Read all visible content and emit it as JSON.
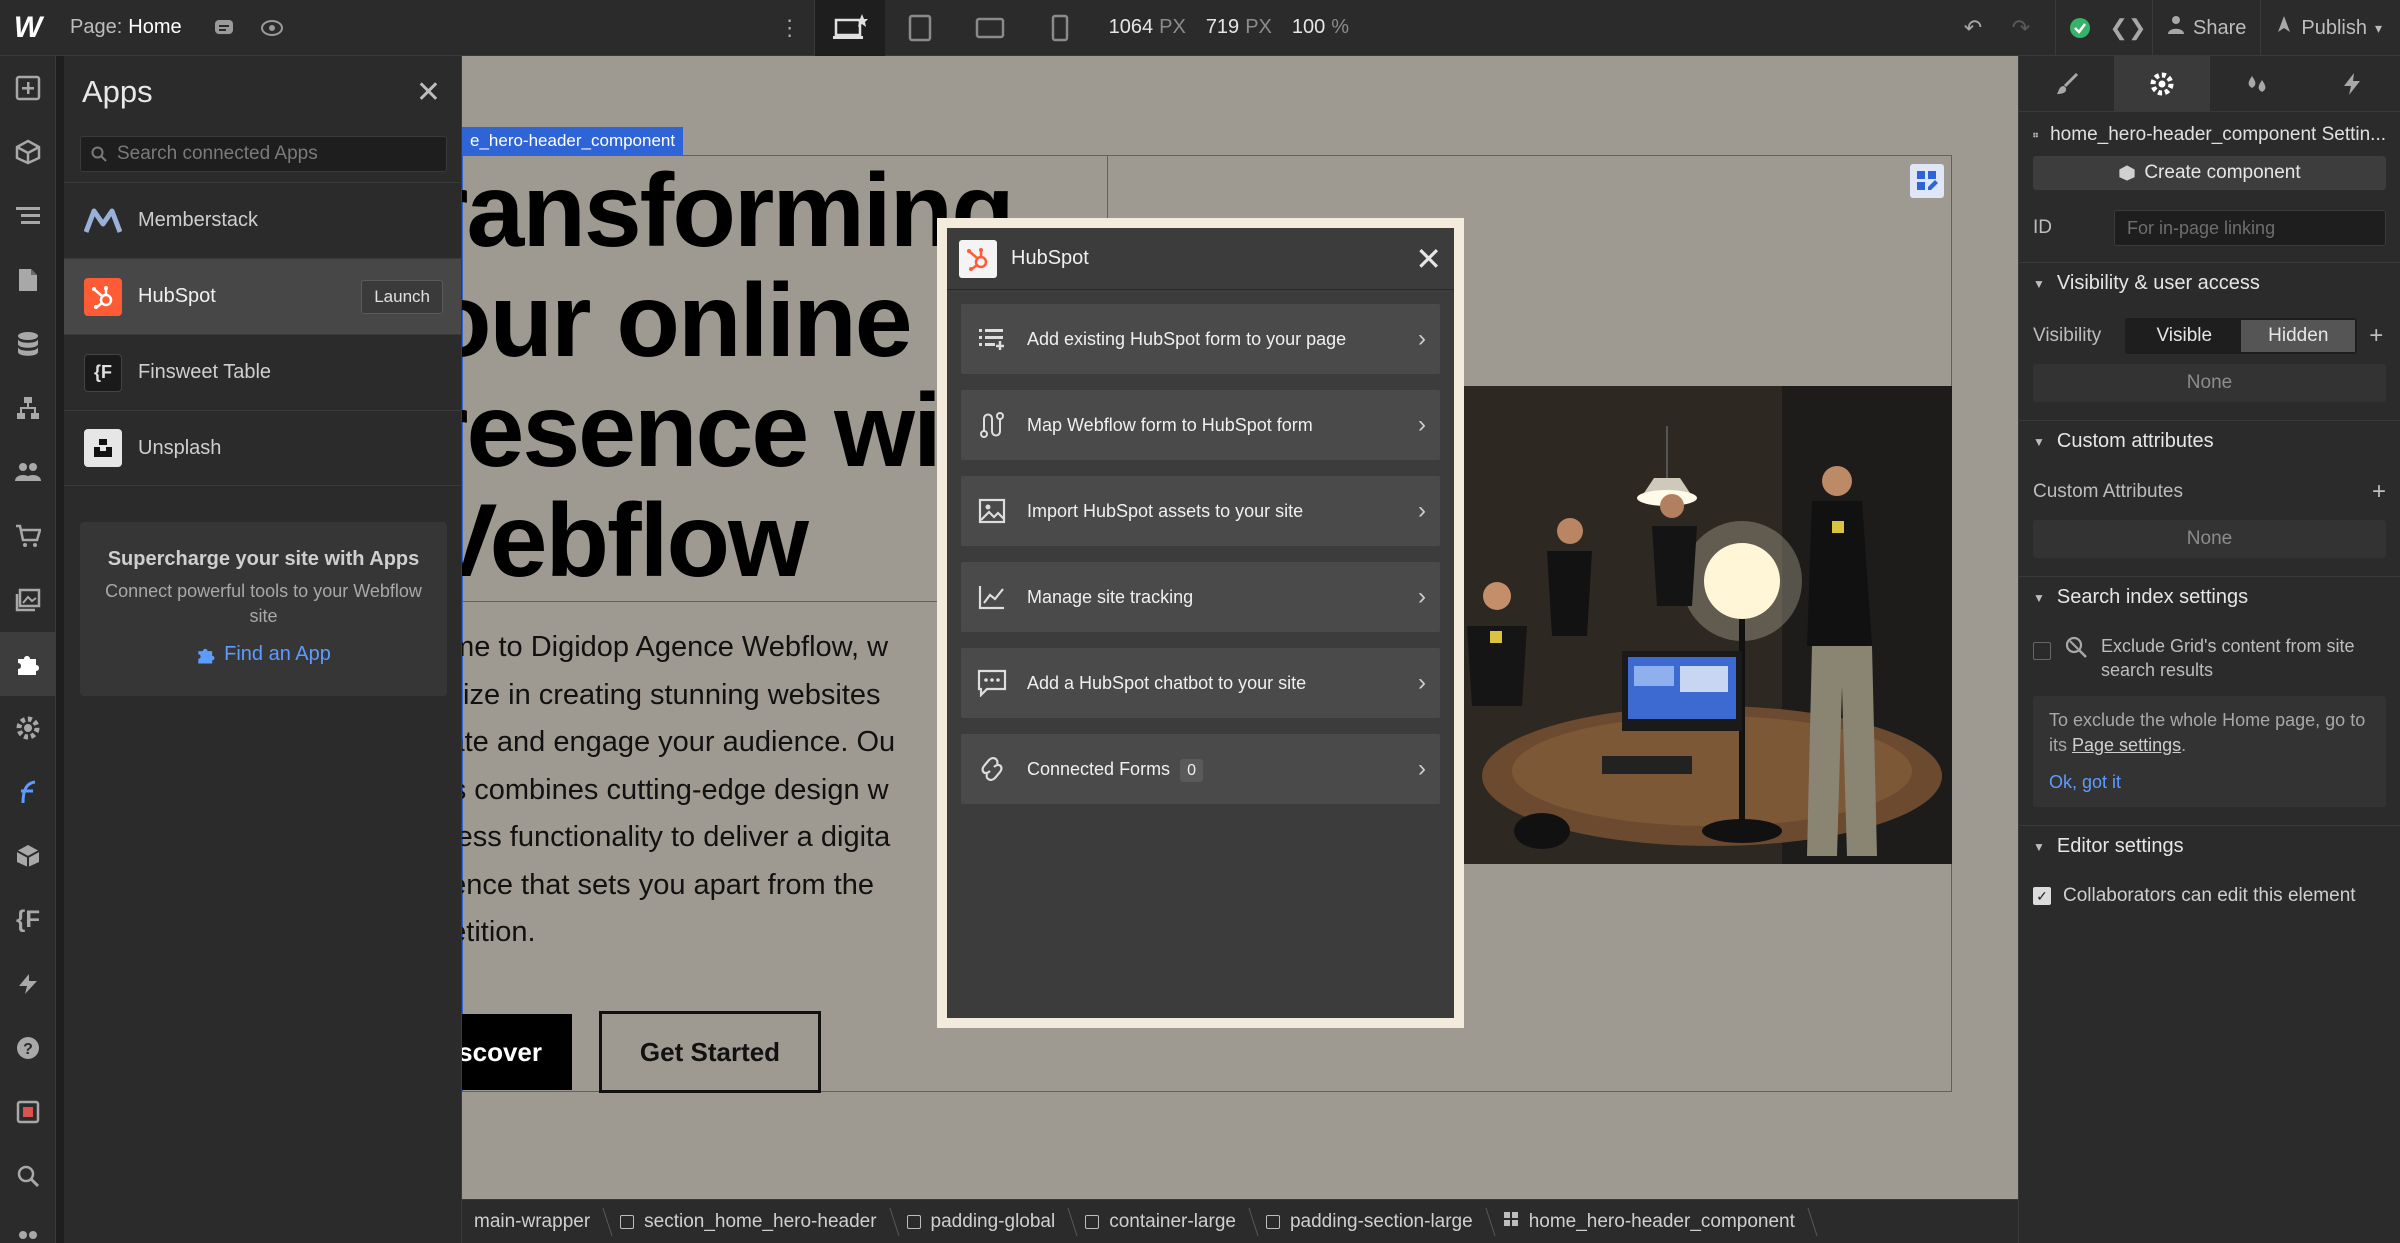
{
  "topbar": {
    "logo": "W",
    "page_prefix": "Page:",
    "page_name": "Home",
    "width_value": "1064",
    "width_unit": "PX",
    "height_value": "719",
    "height_unit": "PX",
    "zoom_value": "100",
    "zoom_unit": "%",
    "share_label": "Share",
    "publish_label": "Publish"
  },
  "apps_panel": {
    "title": "Apps",
    "search_placeholder": "Search connected Apps",
    "items": [
      {
        "label": "Memberstack",
        "icon": "memberstack-icon"
      },
      {
        "label": "HubSpot",
        "icon": "hubspot-icon",
        "action": "Launch"
      },
      {
        "label": "Finsweet Table",
        "icon": "finsweet-icon"
      },
      {
        "label": "Unsplash",
        "icon": "unsplash-icon"
      }
    ],
    "promo": {
      "title": "Supercharge your site with Apps",
      "text": "Connect powerful tools to your Webflow site",
      "link": "Find an App"
    }
  },
  "canvas": {
    "selected_label": "e_hero-header_component",
    "title": "ransforming our online resence wi Vebflow",
    "title_lines": [
      "ransforming",
      "our online",
      "resence wi",
      "Vebflow"
    ],
    "body_lines": [
      "ome to Digidop Agence Webflow, w",
      "ialize in creating stunning websites",
      "vate and engage your audience. Ou",
      "rts combines cutting-edge design w",
      "nless functionality to deliver a digita",
      "rience that sets you apart from the",
      "betition."
    ],
    "button_primary": "scover",
    "button_secondary": "Get Started"
  },
  "hubspot_modal": {
    "title": "HubSpot",
    "items": [
      {
        "label": "Add existing HubSpot form to your page",
        "icon": "form-list-icon"
      },
      {
        "label": "Map Webflow form to HubSpot form",
        "icon": "map-route-icon"
      },
      {
        "label": "Import HubSpot assets to your site",
        "icon": "image-icon"
      },
      {
        "label": "Manage site tracking",
        "icon": "chart-line-icon"
      },
      {
        "label": "Add a HubSpot chatbot to your site",
        "icon": "chat-icon"
      },
      {
        "label": "Connected Forms",
        "icon": "link-icon",
        "count": "0"
      }
    ]
  },
  "breadcrumb": [
    {
      "label": "main-wrapper"
    },
    {
      "label": "section_home_hero-header"
    },
    {
      "label": "padding-global"
    },
    {
      "label": "container-large"
    },
    {
      "label": "padding-section-large"
    },
    {
      "label": "home_hero-header_component"
    }
  ],
  "right_panel": {
    "element_name": "home_hero-header_component Settin...",
    "create_component": "Create component",
    "id_label": "ID",
    "id_placeholder": "For in-page linking",
    "visibility_section": "Visibility & user access",
    "visibility_label": "Visibility",
    "visible_option": "Visible",
    "hidden_option": "Hidden",
    "none_1": "None",
    "custom_attr_section": "Custom attributes",
    "custom_attr_label": "Custom Attributes",
    "none_2": "None",
    "search_index_section": "Search index settings",
    "exclude_text": "Exclude Grid's content from site search results",
    "note_text": "To exclude the whole Home page, go to its",
    "note_link": "Page settings",
    "note_ok": "Ok, got it",
    "editor_section": "Editor settings",
    "collab_label": "Collaborators can edit this element"
  },
  "colors": {
    "accent_blue": "#2f64d6",
    "link_blue": "#5e9bff",
    "hubspot_orange": "#ff5c35",
    "success_green": "#35b368"
  }
}
